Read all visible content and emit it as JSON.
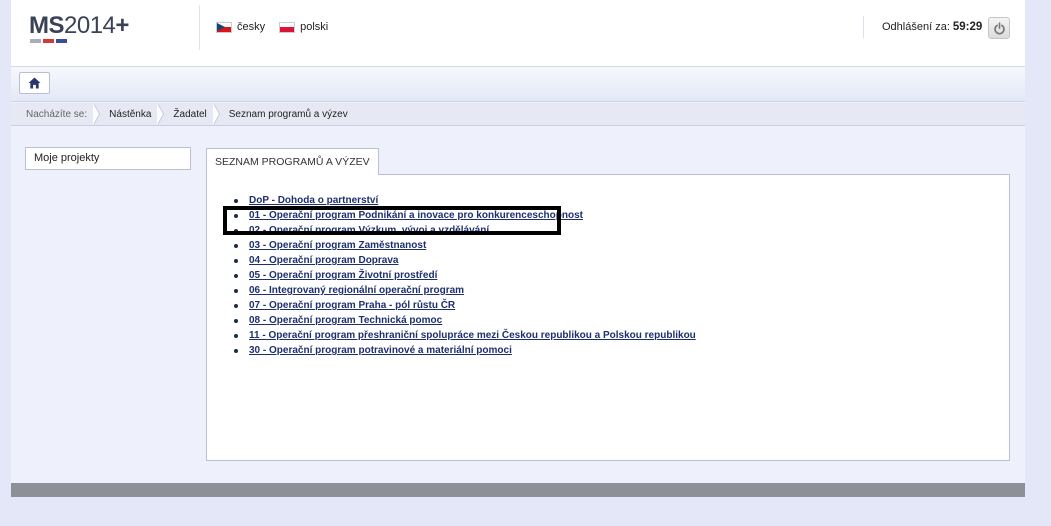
{
  "header": {
    "logo_bold": "MS",
    "logo_light": "2014",
    "logo_plus": "+",
    "logo_colors": [
      "#a9aebb",
      "#d23a3a",
      "#3c4e9a"
    ],
    "languages": [
      {
        "label": "česky",
        "flag": "flag-cz-icon"
      },
      {
        "label": "polski",
        "flag": "flag-pl-icon"
      }
    ],
    "logout_label": "Odhlášení za:",
    "logout_timer": "59:29"
  },
  "toolbar": {
    "home_icon": "home-icon"
  },
  "breadcrumb": {
    "label": "Nacházíte se:",
    "items": [
      "Nástěnka",
      "Žadatel",
      "Seznam programů a výzev"
    ]
  },
  "sidebar": {
    "items": [
      {
        "label": "Moje projekty"
      }
    ]
  },
  "main": {
    "tab_label": "SEZNAM PROGRAMŮ A VÝZEV",
    "programs": [
      "DoP - Dohoda o partnerství",
      "01 - Operační program Podnikání a inovace pro konkurenceschopnost",
      "02 - Operační program Výzkum, vývoj a vzdělávání",
      "03 - Operační program Zaměstnanost",
      "04 - Operační program Doprava",
      "05 - Operační program Životní prostředí",
      "06 - Integrovaný regionální operační program",
      "07 - Operační program Praha - pól růstu ČR",
      "08 - Operační program Technická pomoc",
      "11 - Operační program přeshraniční spolupráce mezi Českou republikou a Polskou republikou",
      "30 - Operační program potravinové a materiální pomoci"
    ]
  },
  "colors": {
    "link": "#1e2f6e",
    "page_bg": "#e3e7f7",
    "highlight": "#000000"
  }
}
